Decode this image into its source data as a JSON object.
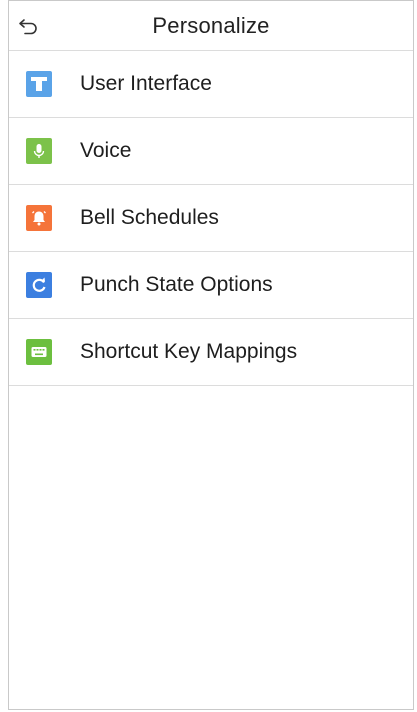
{
  "header": {
    "title": "Personalize"
  },
  "menu": {
    "items": [
      {
        "label": "User Interface",
        "icon": "user-interface-icon",
        "color": "#5aa3e8"
      },
      {
        "label": "Voice",
        "icon": "microphone-icon",
        "color": "#7cc24a"
      },
      {
        "label": "Bell Schedules",
        "icon": "bell-icon",
        "color": "#f5743a"
      },
      {
        "label": "Punch State Options",
        "icon": "refresh-icon",
        "color": "#3c7fe0"
      },
      {
        "label": "Shortcut Key Mappings",
        "icon": "keyboard-icon",
        "color": "#6cbf3f"
      }
    ]
  }
}
